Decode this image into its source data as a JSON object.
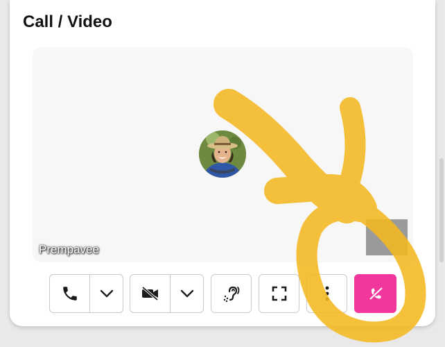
{
  "panel": {
    "title": "Call / Video"
  },
  "video": {
    "participant_name": "Prempavee"
  },
  "controls": {
    "call_icon": "phone-icon",
    "video_icon": "video-off-icon",
    "hearing_icon": "hearing-assist-icon",
    "fullscreen_icon": "fullscreen-icon",
    "more_icon": "more-vertical-icon",
    "hangup_icon": "hang-up-icon"
  },
  "colors": {
    "hangup": "#f1379b",
    "scribble": "#f4b820"
  }
}
